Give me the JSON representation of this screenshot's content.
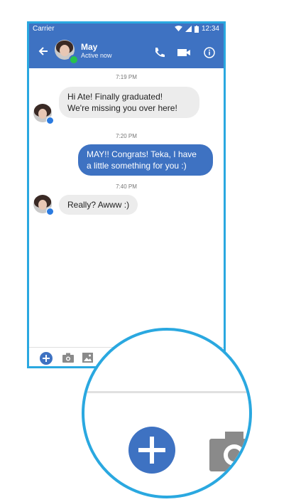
{
  "statusbar": {
    "carrier": "Carrier",
    "time": "12:34"
  },
  "header": {
    "name": "May",
    "status": "Active now"
  },
  "messages": [
    {
      "timestamp": "7:19 PM",
      "direction": "in",
      "lines": [
        "Hi Ate! Finally graduated!",
        "We're missing you over here!"
      ]
    },
    {
      "timestamp": "7:20 PM",
      "direction": "out",
      "lines": [
        "MAY!! Congrats! Teka, I have",
        "a little something for you :)"
      ]
    },
    {
      "timestamp": "7:40 PM",
      "direction": "in",
      "lines": [
        "Really? Awww :)"
      ]
    }
  ],
  "toolbar": {
    "icons": [
      "plus-icon",
      "camera-icon",
      "image-icon"
    ]
  },
  "colors": {
    "accent": "#3e72c2",
    "frame": "#2aa8e0",
    "online": "#27c24c",
    "incoming_bubble": "#ececec"
  }
}
